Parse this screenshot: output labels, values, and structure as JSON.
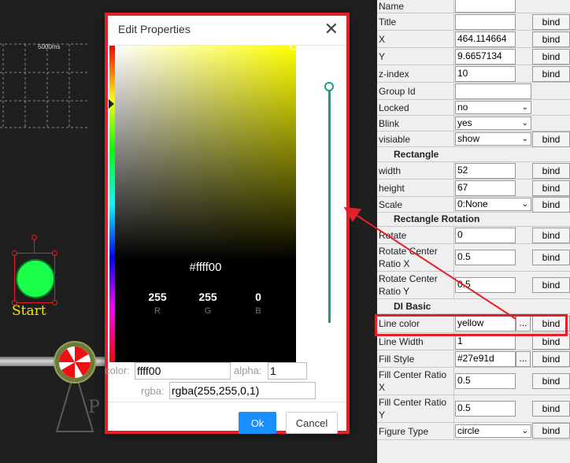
{
  "canvas": {
    "grid_label": "5000ms",
    "start_label": "Start",
    "pump_letter": "P",
    "colors": {
      "background": "#1f1f1f",
      "green": "#19ff4a",
      "start_text": "#f2e600",
      "selection": "#e02020"
    }
  },
  "dialog": {
    "title": "Edit Properties",
    "close_icon": "close-icon",
    "hex_display": "#ffff00",
    "channels": [
      {
        "value": "255",
        "label": "R"
      },
      {
        "value": "255",
        "label": "G"
      },
      {
        "value": "0",
        "label": "B"
      }
    ],
    "color_label": "color:",
    "color_value": "ffff00",
    "alpha_label": "alpha:",
    "alpha_value": "1",
    "rgba_label": "rgba:",
    "rgba_value": "rgba(255,255,0,1)",
    "ok_label": "Ok",
    "cancel_label": "Cancel",
    "accent": "#1890ff",
    "alpha_color": "#1a9c8c"
  },
  "properties": {
    "rows": {
      "name": {
        "label": "Name",
        "value": ""
      },
      "title": {
        "label": "Title",
        "value": "",
        "bind": "bind"
      },
      "x": {
        "label": "X",
        "value": "464.114664",
        "bind": "bind"
      },
      "y": {
        "label": "Y",
        "value": "9.6657134",
        "bind": "bind"
      },
      "zindex": {
        "label": "z-index",
        "value": "10",
        "bind": "bind"
      },
      "group": {
        "label": "Group Id",
        "value": ""
      },
      "locked": {
        "label": "Locked",
        "value": "no"
      },
      "blink": {
        "label": "Blink",
        "value": "yes"
      },
      "visiable": {
        "label": "visiable",
        "value": "show",
        "bind": "bind"
      },
      "width": {
        "label": "width",
        "value": "52",
        "bind": "bind"
      },
      "height": {
        "label": "height",
        "value": "67",
        "bind": "bind"
      },
      "scale": {
        "label": "Scale",
        "value": "0:None",
        "bind": "bind"
      },
      "rotate": {
        "label": "Rotate",
        "value": "0",
        "bind": "bind"
      },
      "rcx": {
        "label": "Rotate Center Ratio X",
        "value": "0.5",
        "bind": "bind"
      },
      "rcy": {
        "label": "Rotate Center Ratio Y",
        "value": "0.5",
        "bind": "bind"
      },
      "linecolor": {
        "label": "Line color",
        "value": "yellow",
        "dots": "...",
        "bind": "bind"
      },
      "linewidth": {
        "label": "Line Width",
        "value": "1",
        "bind": "bind"
      },
      "fillstyle": {
        "label": "Fill Style",
        "value": "#27e91d",
        "dots": "...",
        "bind": "bind"
      },
      "fcx": {
        "label": "Fill Center Ratio X",
        "value": "0.5",
        "bind": "bind"
      },
      "fcy": {
        "label": "Fill Center Ratio Y",
        "value": "0.5",
        "bind": "bind"
      },
      "figuretype": {
        "label": "Figure Type",
        "value": "circle",
        "bind": "bind"
      }
    },
    "sections": {
      "rectangle": "Rectangle",
      "rectangle_rotation": "Rectangle Rotation",
      "di_basic": "DI Basic"
    }
  },
  "annotation": {
    "color": "#e3202a"
  }
}
